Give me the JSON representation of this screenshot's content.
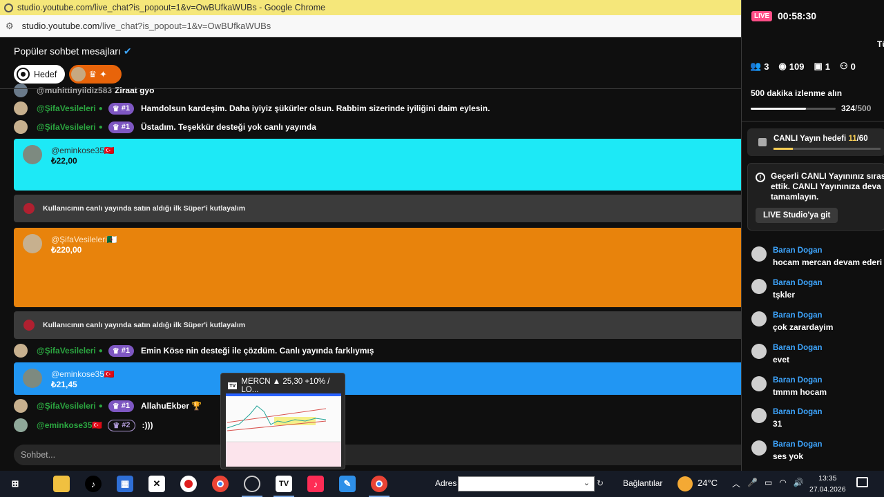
{
  "window": {
    "title": "studio.youtube.com/live_chat?is_popout=1&v=OwBUfkaWUBs - Google Chrome",
    "url_domain": "studio.youtube.com",
    "url_path": "/live_chat?is_popout=1&v=OwBUfkaWUBs"
  },
  "chat": {
    "header": "Popüler sohbet mesajları",
    "chip_hedef": "Hedef",
    "input_placeholder": "Sohbet...",
    "rows": [
      {
        "name": "@muhittinyildiz583",
        "message": "Ziraat gyo"
      },
      {
        "name": "@ŞifaVesileleri",
        "rank": "#1",
        "message": "Hamdolsun kardeşim. Daha iyiyiz şükürler olsun. Rabbim sizerinde iyiliğini daim eylesin."
      },
      {
        "name": "@ŞifaVesileleri",
        "rank": "#1",
        "message": "Üstadım. Teşekkür desteği yok canlı yayında"
      },
      {
        "name": "@ŞifaVesileleri",
        "rank": "#1",
        "message": "Emin Köse nin desteği ile çözdüm. Canlı yayında farklıymış"
      },
      {
        "name": "@ŞifaVesileleri",
        "rank": "#1",
        "message": "AllahuEkber 🏆"
      },
      {
        "name": "@eminkose35🇹🇷",
        "rank": "#2",
        "message": ":)))"
      }
    ],
    "superchats": [
      {
        "name": "@eminkose35🇹🇷",
        "amount": "₺22,00",
        "color": "#1de9f6"
      },
      {
        "name": "@ŞifaVesileleri🇩🇿",
        "amount": "₺220,00",
        "color": "#e8830c"
      },
      {
        "name": "@eminkose35🇹🇷",
        "amount": "₺21,45",
        "color": "#2196f3"
      }
    ],
    "banner_text": "Kullanıcının canlı yayında satın aldığı ilk Süper'i kutlayalım"
  },
  "popup": {
    "title": "MERCN ▲ 25,30 +10% / LO..."
  },
  "sidebar": {
    "live_label": "LIVE",
    "live_time": "00:58:30",
    "cut_text": "Tü",
    "stats": {
      "viewers": "3",
      "views": "109",
      "gifts": "1",
      "members": "0"
    },
    "goal_title": "500 dakika izlenme alın",
    "goal_value": "324",
    "goal_total": "/500",
    "goal_progress": 0.648,
    "canli_label": "CANLI Yayın hedefi ",
    "canli_value": "11",
    "canli_total": "/60",
    "canli_progress": 0.183,
    "warning_text": "Geçerli CANLI Yayınınız sırası\nettik. CANLI Yayınınıza deva\ntamamlayın.",
    "warning_button": "LIVE Studio'ya git",
    "messages": [
      {
        "name": "Baran Dogan",
        "text": "hocam mercan devam ederi"
      },
      {
        "name": "Baran Dogan",
        "text": "tşkler"
      },
      {
        "name": "Baran Dogan",
        "text": "çok zarardayim"
      },
      {
        "name": "Baran Dogan",
        "text": "evet"
      },
      {
        "name": "Baran Dogan",
        "text": "tmmm hocam"
      },
      {
        "name": "Baran Dogan",
        "text": "31"
      },
      {
        "name": "Baran Dogan",
        "text": "ses yok"
      }
    ]
  },
  "taskbar": {
    "adres_label": "Adres",
    "links_label": "Bağlantılar",
    "temperature": "24°C",
    "time": "13:35",
    "date": "27.04.2026"
  }
}
